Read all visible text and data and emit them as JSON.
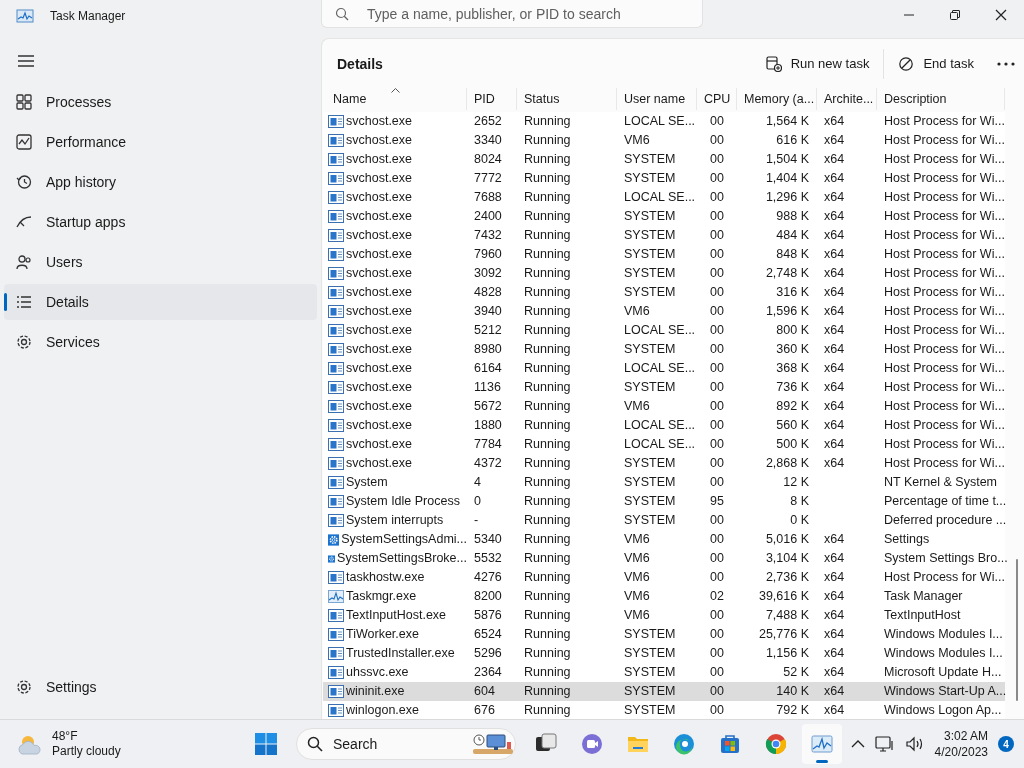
{
  "window": {
    "title": "Task Manager"
  },
  "search": {
    "placeholder": "Type a name, publisher, or PID to search"
  },
  "sidebar": {
    "items": [
      {
        "label": "Processes",
        "kind": "processes",
        "selected": false
      },
      {
        "label": "Performance",
        "kind": "performance",
        "selected": false
      },
      {
        "label": "App history",
        "kind": "history",
        "selected": false
      },
      {
        "label": "Startup apps",
        "kind": "startup",
        "selected": false
      },
      {
        "label": "Users",
        "kind": "users",
        "selected": false
      },
      {
        "label": "Details",
        "kind": "details",
        "selected": true
      },
      {
        "label": "Services",
        "kind": "services",
        "selected": false
      }
    ],
    "footer": {
      "label": "Settings"
    }
  },
  "page": {
    "title": "Details",
    "actions": [
      {
        "label": "Run new task",
        "kind": "run"
      },
      {
        "label": "End task",
        "kind": "end"
      }
    ]
  },
  "table": {
    "columns": [
      {
        "label": "Name",
        "sorted": true
      },
      {
        "label": "PID",
        "sorted": false
      },
      {
        "label": "Status",
        "sorted": false
      },
      {
        "label": "User name",
        "sorted": false
      },
      {
        "label": "CPU",
        "sorted": false
      },
      {
        "label": "Memory (a...",
        "sorted": false
      },
      {
        "label": "Archite...",
        "sorted": false
      },
      {
        "label": "Description",
        "sorted": false
      }
    ],
    "rows": [
      {
        "name": "svchost.exe",
        "pid": "2652",
        "status": "Running",
        "user": "LOCAL SE...",
        "cpu": "00",
        "memory": "1,564 K",
        "arch": "x64",
        "description": "Host Process for Wi...",
        "kind": "process",
        "selected": false
      },
      {
        "name": "svchost.exe",
        "pid": "3340",
        "status": "Running",
        "user": "VM6",
        "cpu": "00",
        "memory": "616 K",
        "arch": "x64",
        "description": "Host Process for Wi...",
        "kind": "process",
        "selected": false
      },
      {
        "name": "svchost.exe",
        "pid": "8024",
        "status": "Running",
        "user": "SYSTEM",
        "cpu": "00",
        "memory": "1,504 K",
        "arch": "x64",
        "description": "Host Process for Wi...",
        "kind": "process",
        "selected": false
      },
      {
        "name": "svchost.exe",
        "pid": "7772",
        "status": "Running",
        "user": "SYSTEM",
        "cpu": "00",
        "memory": "1,404 K",
        "arch": "x64",
        "description": "Host Process for Wi...",
        "kind": "process",
        "selected": false
      },
      {
        "name": "svchost.exe",
        "pid": "7688",
        "status": "Running",
        "user": "LOCAL SE...",
        "cpu": "00",
        "memory": "1,296 K",
        "arch": "x64",
        "description": "Host Process for Wi...",
        "kind": "process",
        "selected": false
      },
      {
        "name": "svchost.exe",
        "pid": "2400",
        "status": "Running",
        "user": "SYSTEM",
        "cpu": "00",
        "memory": "988 K",
        "arch": "x64",
        "description": "Host Process for Wi...",
        "kind": "process",
        "selected": false
      },
      {
        "name": "svchost.exe",
        "pid": "7432",
        "status": "Running",
        "user": "SYSTEM",
        "cpu": "00",
        "memory": "484 K",
        "arch": "x64",
        "description": "Host Process for Wi...",
        "kind": "process",
        "selected": false
      },
      {
        "name": "svchost.exe",
        "pid": "7960",
        "status": "Running",
        "user": "SYSTEM",
        "cpu": "00",
        "memory": "848 K",
        "arch": "x64",
        "description": "Host Process for Wi...",
        "kind": "process",
        "selected": false
      },
      {
        "name": "svchost.exe",
        "pid": "3092",
        "status": "Running",
        "user": "SYSTEM",
        "cpu": "00",
        "memory": "2,748 K",
        "arch": "x64",
        "description": "Host Process for Wi...",
        "kind": "process",
        "selected": false
      },
      {
        "name": "svchost.exe",
        "pid": "4828",
        "status": "Running",
        "user": "SYSTEM",
        "cpu": "00",
        "memory": "316 K",
        "arch": "x64",
        "description": "Host Process for Wi...",
        "kind": "process",
        "selected": false
      },
      {
        "name": "svchost.exe",
        "pid": "3940",
        "status": "Running",
        "user": "VM6",
        "cpu": "00",
        "memory": "1,596 K",
        "arch": "x64",
        "description": "Host Process for Wi...",
        "kind": "process",
        "selected": false
      },
      {
        "name": "svchost.exe",
        "pid": "5212",
        "status": "Running",
        "user": "LOCAL SE...",
        "cpu": "00",
        "memory": "800 K",
        "arch": "x64",
        "description": "Host Process for Wi...",
        "kind": "process",
        "selected": false
      },
      {
        "name": "svchost.exe",
        "pid": "8980",
        "status": "Running",
        "user": "SYSTEM",
        "cpu": "00",
        "memory": "360 K",
        "arch": "x64",
        "description": "Host Process for Wi...",
        "kind": "process",
        "selected": false
      },
      {
        "name": "svchost.exe",
        "pid": "6164",
        "status": "Running",
        "user": "LOCAL SE...",
        "cpu": "00",
        "memory": "368 K",
        "arch": "x64",
        "description": "Host Process for Wi...",
        "kind": "process",
        "selected": false
      },
      {
        "name": "svchost.exe",
        "pid": "1136",
        "status": "Running",
        "user": "SYSTEM",
        "cpu": "00",
        "memory": "736 K",
        "arch": "x64",
        "description": "Host Process for Wi...",
        "kind": "process",
        "selected": false
      },
      {
        "name": "svchost.exe",
        "pid": "5672",
        "status": "Running",
        "user": "VM6",
        "cpu": "00",
        "memory": "892 K",
        "arch": "x64",
        "description": "Host Process for Wi...",
        "kind": "process",
        "selected": false
      },
      {
        "name": "svchost.exe",
        "pid": "1880",
        "status": "Running",
        "user": "LOCAL SE...",
        "cpu": "00",
        "memory": "560 K",
        "arch": "x64",
        "description": "Host Process for Wi...",
        "kind": "process",
        "selected": false
      },
      {
        "name": "svchost.exe",
        "pid": "7784",
        "status": "Running",
        "user": "LOCAL SE...",
        "cpu": "00",
        "memory": "500 K",
        "arch": "x64",
        "description": "Host Process for Wi...",
        "kind": "process",
        "selected": false
      },
      {
        "name": "svchost.exe",
        "pid": "4372",
        "status": "Running",
        "user": "SYSTEM",
        "cpu": "00",
        "memory": "2,868 K",
        "arch": "x64",
        "description": "Host Process for Wi...",
        "kind": "process",
        "selected": false
      },
      {
        "name": "System",
        "pid": "4",
        "status": "Running",
        "user": "SYSTEM",
        "cpu": "00",
        "memory": "12 K",
        "description": "NT Kernel & System",
        "kind": "process",
        "selected": false
      },
      {
        "name": "System Idle Process",
        "pid": "0",
        "status": "Running",
        "user": "SYSTEM",
        "cpu": "95",
        "memory": "8 K",
        "description": "Percentage of time t...",
        "kind": "process",
        "selected": false
      },
      {
        "name": "System interrupts",
        "pid": "-",
        "status": "Running",
        "user": "SYSTEM",
        "cpu": "00",
        "memory": "0 K",
        "description": "Deferred procedure ...",
        "kind": "process",
        "selected": false
      },
      {
        "name": "SystemSettingsAdmi...",
        "pid": "5340",
        "status": "Running",
        "user": "VM6",
        "cpu": "00",
        "memory": "5,016 K",
        "arch": "x64",
        "description": "Settings",
        "kind": "gear",
        "selected": false
      },
      {
        "name": "SystemSettingsBroke...",
        "pid": "5532",
        "status": "Running",
        "user": "VM6",
        "cpu": "00",
        "memory": "3,104 K",
        "arch": "x64",
        "description": "System Settings Bro...",
        "kind": "gear",
        "selected": false
      },
      {
        "name": "taskhostw.exe",
        "pid": "4276",
        "status": "Running",
        "user": "VM6",
        "cpu": "00",
        "memory": "2,736 K",
        "arch": "x64",
        "description": "Host Process for Wi...",
        "kind": "process",
        "selected": false
      },
      {
        "name": "Taskmgr.exe",
        "pid": "8200",
        "status": "Running",
        "user": "VM6",
        "cpu": "02",
        "memory": "39,616 K",
        "arch": "x64",
        "description": "Task Manager",
        "kind": "chart",
        "selected": false
      },
      {
        "name": "TextInputHost.exe",
        "pid": "5876",
        "status": "Running",
        "user": "VM6",
        "cpu": "00",
        "memory": "7,488 K",
        "arch": "x64",
        "description": "TextInputHost",
        "kind": "process",
        "selected": false
      },
      {
        "name": "TiWorker.exe",
        "pid": "6524",
        "status": "Running",
        "user": "SYSTEM",
        "cpu": "00",
        "memory": "25,776 K",
        "arch": "x64",
        "description": "Windows Modules I...",
        "kind": "process",
        "selected": false
      },
      {
        "name": "TrustedInstaller.exe",
        "pid": "5296",
        "status": "Running",
        "user": "SYSTEM",
        "cpu": "00",
        "memory": "1,156 K",
        "arch": "x64",
        "description": "Windows Modules I...",
        "kind": "process",
        "selected": false
      },
      {
        "name": "uhssvc.exe",
        "pid": "2364",
        "status": "Running",
        "user": "SYSTEM",
        "cpu": "00",
        "memory": "52 K",
        "arch": "x64",
        "description": "Microsoft Update H...",
        "kind": "process",
        "selected": false
      },
      {
        "name": "wininit.exe",
        "pid": "604",
        "status": "Running",
        "user": "SYSTEM",
        "cpu": "00",
        "memory": "140 K",
        "arch": "x64",
        "description": "Windows Start-Up A...",
        "kind": "process",
        "selected": true
      },
      {
        "name": "winlogon.exe",
        "pid": "676",
        "status": "Running",
        "user": "SYSTEM",
        "cpu": "00",
        "memory": "792 K",
        "arch": "x64",
        "description": "Windows Logon Ap...",
        "kind": "process",
        "selected": false
      }
    ]
  },
  "taskbar": {
    "weather": {
      "temperature": "48°F",
      "condition": "Partly cloudy"
    },
    "search": {
      "placeholder": "Search"
    },
    "apps": [
      {
        "kind": "taskview",
        "selected": false
      },
      {
        "kind": "chat",
        "selected": false
      },
      {
        "kind": "folder",
        "selected": false
      },
      {
        "kind": "edge",
        "selected": false
      },
      {
        "kind": "store",
        "selected": false
      },
      {
        "kind": "chrome",
        "selected": false
      },
      {
        "kind": "taskmanager",
        "selected": true
      }
    ],
    "time": "3:02 AM",
    "date": "4/20/2023",
    "notifications": "4"
  }
}
